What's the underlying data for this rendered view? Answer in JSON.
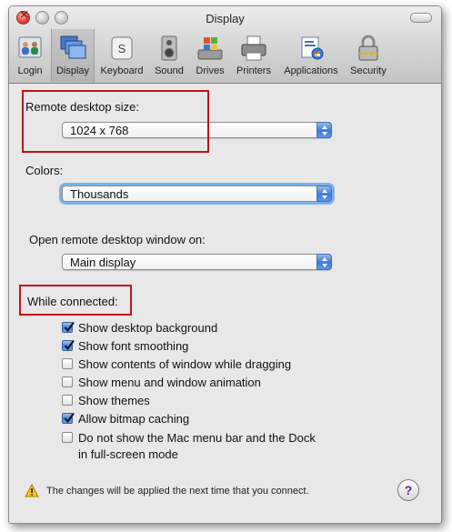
{
  "window": {
    "title": "Display"
  },
  "toolbar": {
    "items": [
      {
        "label": "Login",
        "icon": "login-icon"
      },
      {
        "label": "Display",
        "icon": "display-icon",
        "selected": true
      },
      {
        "label": "Keyboard",
        "icon": "keyboard-icon"
      },
      {
        "label": "Sound",
        "icon": "sound-icon"
      },
      {
        "label": "Drives",
        "icon": "drives-icon"
      },
      {
        "label": "Printers",
        "icon": "printers-icon"
      },
      {
        "label": "Applications",
        "icon": "applications-icon"
      },
      {
        "label": "Security",
        "icon": "security-icon"
      }
    ]
  },
  "settings": {
    "remote_size": {
      "label": "Remote desktop size:",
      "value": "1024 x 768"
    },
    "colors": {
      "label": "Colors:",
      "value": "Thousands"
    },
    "open_on": {
      "label": "Open remote desktop window on:",
      "value": "Main display"
    },
    "while_connected": {
      "label": "While connected:",
      "options": [
        {
          "label": "Show desktop background",
          "checked": true
        },
        {
          "label": "Show font smoothing",
          "checked": true
        },
        {
          "label": "Show contents of window while dragging",
          "checked": false
        },
        {
          "label": "Show menu and window animation",
          "checked": false
        },
        {
          "label": "Show themes",
          "checked": false
        },
        {
          "label": "Allow bitmap caching",
          "checked": true
        },
        {
          "label": "Do not show the Mac menu bar and the Dock",
          "label_line2": "in full-screen mode",
          "checked": false
        }
      ]
    }
  },
  "footer": {
    "notice": "The changes will be applied the next time that you connect.",
    "help_label": "?"
  },
  "colors": {
    "highlight": "#c1121c",
    "accent": "#3f7fdc"
  }
}
